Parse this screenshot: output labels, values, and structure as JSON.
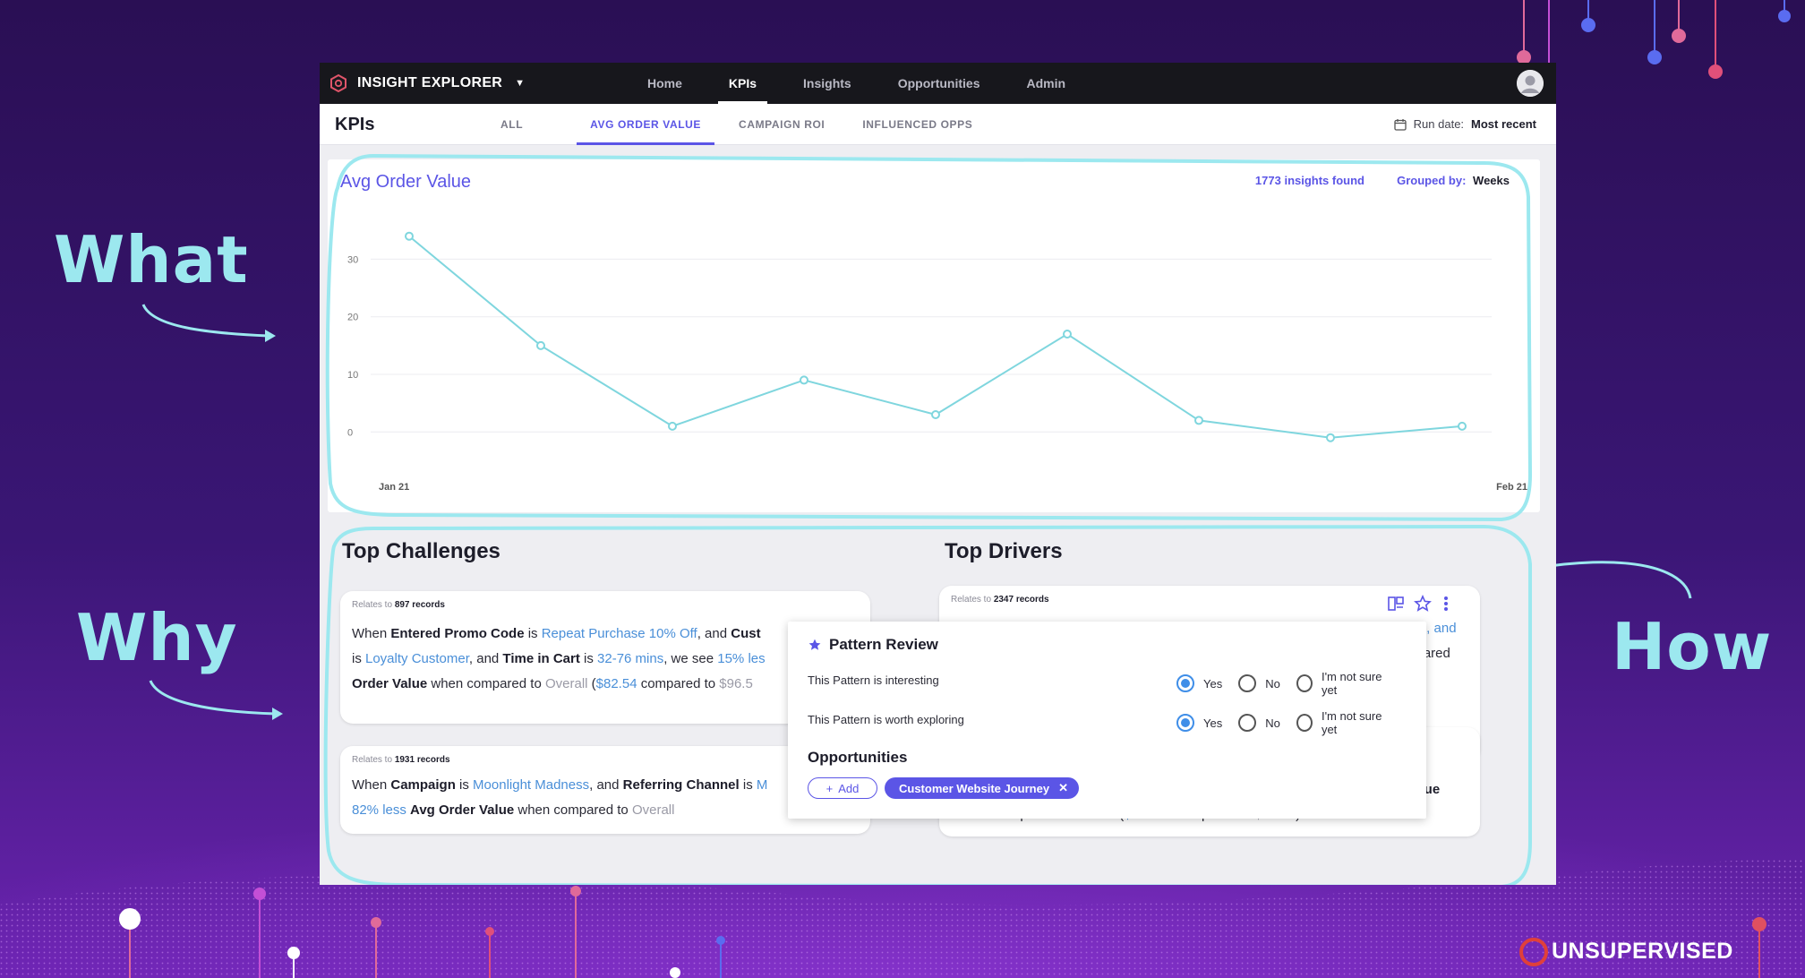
{
  "callouts": {
    "what": "What",
    "why": "Why",
    "how": "How"
  },
  "brand": {
    "name": "UNSUPERVISED"
  },
  "app": {
    "title": "INSIGHT EXPLORER",
    "nav": [
      "Home",
      "KPIs",
      "Insights",
      "Opportunities",
      "Admin"
    ],
    "active_nav": "KPIs",
    "page_title": "KPIs",
    "subtabs": [
      "ALL",
      "AVG ORDER VALUE",
      "CAMPAIGN ROI",
      "INFLUENCED OPPS"
    ],
    "active_subtab": "AVG ORDER VALUE",
    "run_date_label": "Run date:",
    "run_date_value": "Most recent"
  },
  "chart_header": {
    "title": "Avg Order Value",
    "insights_count": "1773",
    "insights_suffix": "insights found",
    "grouped_label": "Grouped by:",
    "grouped_value": "Weeks"
  },
  "chart_data": {
    "type": "line",
    "title": "Avg Order Value",
    "x_labels": [
      "Jan 21",
      "Feb 21"
    ],
    "values": [
      34,
      15,
      1,
      9,
      3,
      17,
      2,
      -1,
      1
    ],
    "yticks": [
      0,
      10,
      20,
      30
    ],
    "ylim": [
      -4,
      38
    ],
    "grid": true,
    "color": "#7fd6de"
  },
  "challenges": {
    "title": "Top Challenges",
    "cards": [
      {
        "relates_prefix": "Relates to",
        "relates_count": "897 records",
        "line1": [
          "When ",
          "Entered Promo Code",
          " is ",
          "Repeat Purchase 10% Off",
          ", and ",
          "Cust"
        ],
        "line2": [
          "is ",
          "Loyalty Customer",
          ", and ",
          "Time in Cart",
          " is ",
          "32-76 mins",
          ", we see ",
          "15% les"
        ],
        "line3": [
          "Order Value",
          " when compared to ",
          "Overall",
          " (",
          "$82.54",
          " compared to ",
          "$96.5"
        ]
      },
      {
        "relates_prefix": "Relates to",
        "relates_count": "1931 records",
        "line1": [
          "When ",
          "Campaign",
          " is ",
          "Moonlight Madness",
          ", and ",
          "Referring Channel",
          " is ",
          "M"
        ],
        "line2": [
          "82% less",
          " ",
          "Avg Order Value",
          " when compared to ",
          "Overall"
        ]
      }
    ]
  },
  "drivers": {
    "title": "Top Drivers",
    "cards": [
      {
        "relates_prefix": "Relates to",
        "relates_count": "2347 records",
        "line1_end": "ads, and",
        "line2_end": "mpared"
      },
      {
        "line1_end": "and",
        "line2_end": "Value",
        "line3": [
          "when compared to ",
          "Overall",
          " (",
          "$138.29",
          " compared to ",
          "$96.55",
          ")."
        ]
      }
    ]
  },
  "pattern_review": {
    "title": "Pattern Review",
    "rows": [
      {
        "question": "This Pattern is interesting",
        "options": [
          "Yes",
          "No",
          "I'm not sure yet"
        ],
        "selected": "Yes"
      },
      {
        "question": "This Pattern is worth exploring",
        "options": [
          "Yes",
          "No",
          "I'm not sure yet"
        ],
        "selected": "Yes"
      }
    ],
    "opportunities_title": "Opportunities",
    "add_label": "Add",
    "chip_label": "Customer Website Journey"
  }
}
